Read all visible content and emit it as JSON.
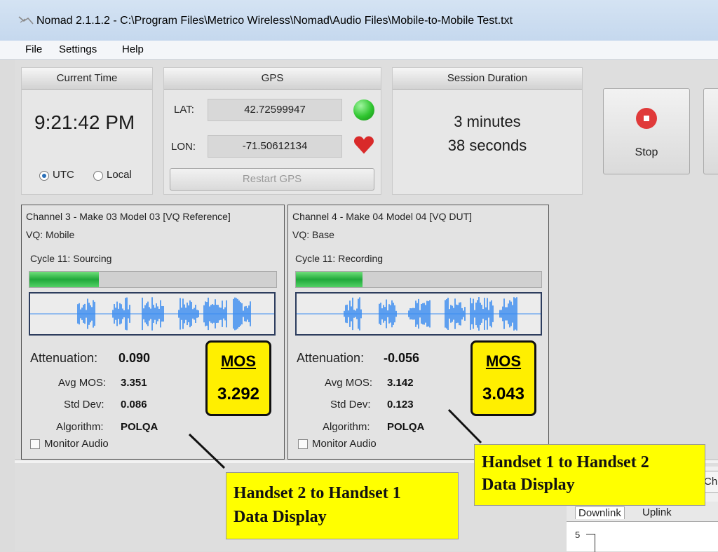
{
  "window": {
    "title": "Nomad 2.1.1.2 - C:\\Program Files\\Metrico Wireless\\Nomad\\Audio Files\\Mobile-to-Mobile Test.txt"
  },
  "menu": {
    "items": [
      "File",
      "Settings",
      "Help"
    ]
  },
  "current_time": {
    "header": "Current Time",
    "value": "9:21:42 PM",
    "utc_label": "UTC",
    "local_label": "Local",
    "selected": "UTC"
  },
  "gps": {
    "header": "GPS",
    "lat_label": "LAT:",
    "lat_value": "42.72599947",
    "lon_label": "LON:",
    "lon_value": "-71.50612134",
    "restart_label": "Restart GPS",
    "status_color": "#2fc52f",
    "heart_color": "#d92a2a"
  },
  "session": {
    "header": "Session Duration",
    "line1": "3 minutes",
    "line2": "38 seconds"
  },
  "toolbar": {
    "stop_label": "Stop",
    "stop_color": "#e03a3a"
  },
  "channels": [
    {
      "title": "Channel 3 - Make 03 Model 03 [VQ Reference]",
      "vq": "VQ: Mobile",
      "cycle": "Cycle 11: Sourcing",
      "progress": 0.28,
      "attenuation_label": "Attenuation:",
      "attenuation": "0.090",
      "avg_mos_label": "Avg MOS:",
      "avg_mos": "3.351",
      "std_dev_label": "Std Dev:",
      "std_dev": "0.086",
      "algorithm_label": "Algorithm:",
      "algorithm": "POLQA",
      "mos_label": "MOS",
      "mos": "3.292",
      "monitor_label": "Monitor Audio"
    },
    {
      "title": "Channel 4 - Make 04 Model 04 [VQ DUT]",
      "vq": "VQ: Base",
      "cycle": "Cycle 11: Recording",
      "progress": 0.27,
      "attenuation_label": "Attenuation:",
      "attenuation": "-0.056",
      "avg_mos_label": "Avg MOS:",
      "avg_mos": "3.142",
      "std_dev_label": "Std Dev:",
      "std_dev": "0.123",
      "algorithm_label": "Algorithm:",
      "algorithm": "POLQA",
      "mos_label": "MOS",
      "mos": "3.043",
      "monitor_label": "Monitor Audio"
    }
  ],
  "annotations": {
    "left": [
      "Handset 2 to Handset 1",
      "Data Display"
    ],
    "right": [
      "Handset 1 to Handset 2",
      "Data Display"
    ]
  },
  "bottom": {
    "tabs": [
      "Downlink",
      "Uplink"
    ],
    "partial_tab": "Ch",
    "axis_tick": "5"
  },
  "colors": {
    "wave": "#3b8cf0",
    "callout": "#ffff00",
    "mos_box": "#ffef00"
  }
}
